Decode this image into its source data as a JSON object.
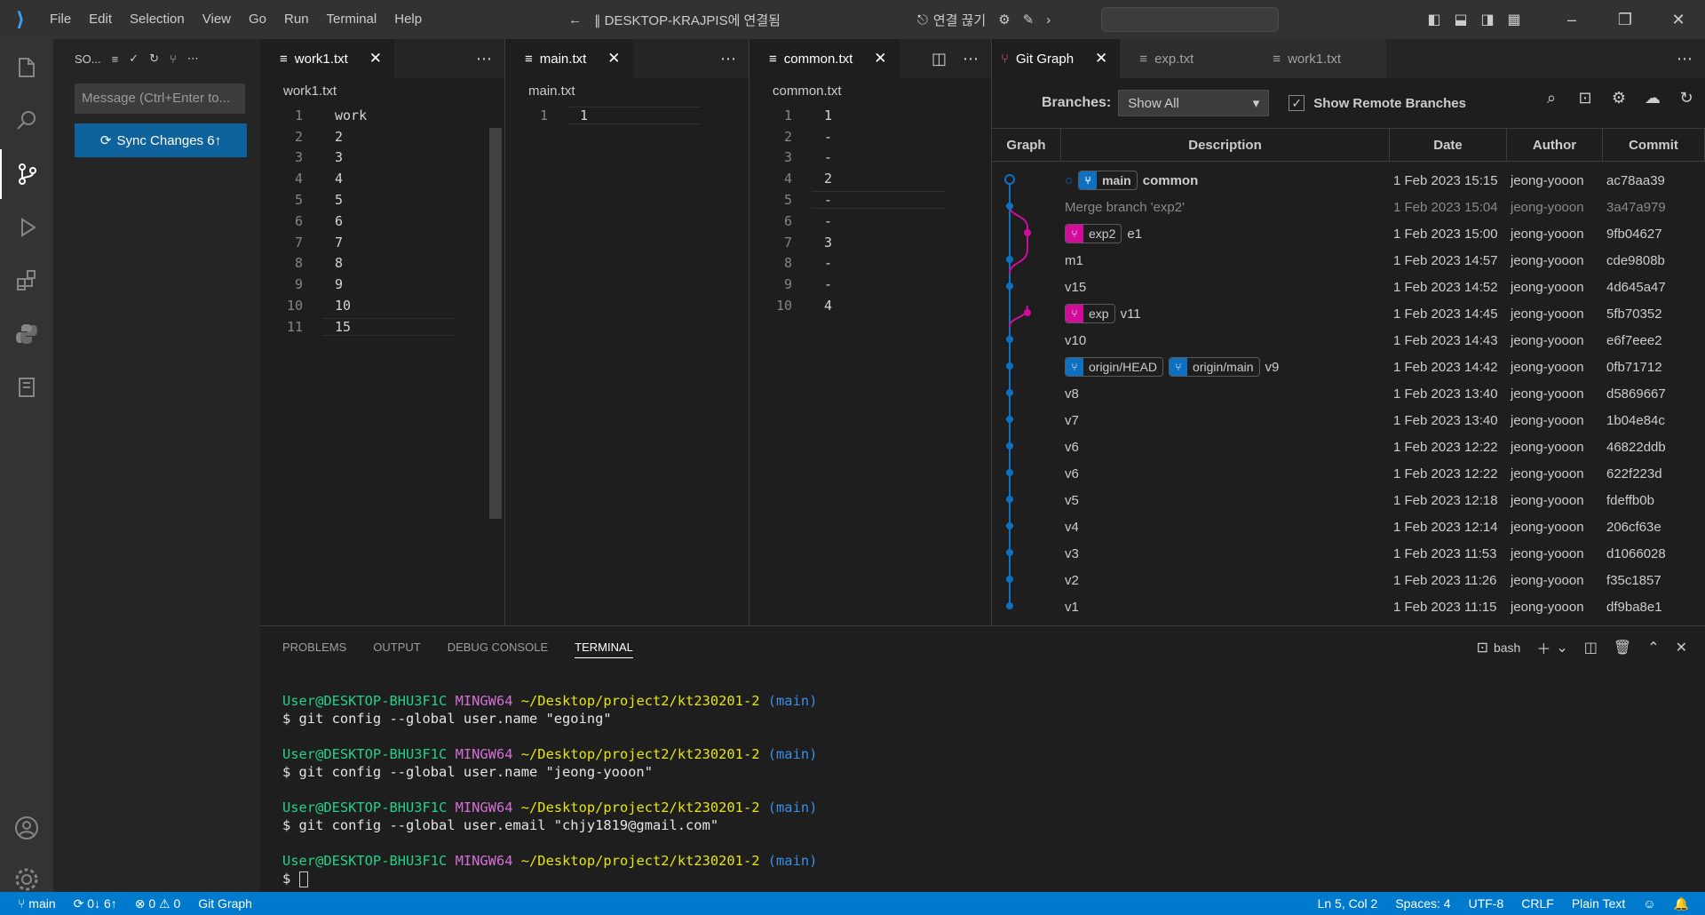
{
  "titlebar": {
    "menu": [
      "File",
      "Edit",
      "Selection",
      "View",
      "Go",
      "Run",
      "Terminal",
      "Help"
    ],
    "remote_title": "∥ DESKTOP-KRAJPIS에 연결됨",
    "disconnect": "연결 끊기"
  },
  "sidebar": {
    "title": "SO...",
    "message_placeholder": "Message (Ctrl+Enter to...",
    "sync_label": "Sync Changes 6↑"
  },
  "editors": [
    {
      "tab": "work1.txt",
      "crumb": "work1.txt",
      "lines": [
        "work",
        "2",
        "3",
        "4",
        "5",
        "6",
        "7",
        "8",
        "9",
        "10",
        "15"
      ]
    },
    {
      "tab": "main.txt",
      "crumb": "main.txt",
      "lines": [
        "1"
      ]
    },
    {
      "tab": "common.txt",
      "crumb": "common.txt",
      "lines": [
        "1",
        "-",
        "-",
        "2",
        "-",
        "-",
        "3",
        "-",
        "-",
        "4"
      ]
    }
  ],
  "gitgraph": {
    "tabs": [
      "Git Graph",
      "exp.txt",
      "work1.txt"
    ],
    "branches_label": "Branches:",
    "branches_value": "Show All",
    "show_remote_label": "Show Remote Branches",
    "columns": [
      "Graph",
      "Description",
      "Date",
      "Author",
      "Commit"
    ],
    "rows": [
      {
        "refs": [
          {
            "name": "main",
            "color": "blue",
            "head": true
          }
        ],
        "desc": "common",
        "date": "1 Feb 2023 15:15",
        "author": "jeong-yooon",
        "commit": "ac78aa39"
      },
      {
        "refs": [],
        "desc": "Merge branch 'exp2'",
        "date": "1 Feb 2023 15:04",
        "author": "jeong-yooon",
        "commit": "3a47a979",
        "dim": true
      },
      {
        "refs": [
          {
            "name": "exp2",
            "color": "pink"
          }
        ],
        "desc": "e1",
        "date": "1 Feb 2023 15:00",
        "author": "jeong-yooon",
        "commit": "9fb04627"
      },
      {
        "refs": [],
        "desc": "m1",
        "date": "1 Feb 2023 14:57",
        "author": "jeong-yooon",
        "commit": "cde9808b"
      },
      {
        "refs": [],
        "desc": "v15",
        "date": "1 Feb 2023 14:52",
        "author": "jeong-yooon",
        "commit": "4d645a47"
      },
      {
        "refs": [
          {
            "name": "exp",
            "color": "pink"
          }
        ],
        "desc": "v11",
        "date": "1 Feb 2023 14:45",
        "author": "jeong-yooon",
        "commit": "5fb70352"
      },
      {
        "refs": [],
        "desc": "v10",
        "date": "1 Feb 2023 14:43",
        "author": "jeong-yooon",
        "commit": "e6f7eee2"
      },
      {
        "refs": [
          {
            "name": "origin/HEAD",
            "color": "blue"
          },
          {
            "name": "origin/main",
            "color": "blue"
          }
        ],
        "desc": "v9",
        "date": "1 Feb 2023 14:42",
        "author": "jeong-yooon",
        "commit": "0fb71712"
      },
      {
        "refs": [],
        "desc": "v8",
        "date": "1 Feb 2023 13:40",
        "author": "jeong-yooon",
        "commit": "d5869667"
      },
      {
        "refs": [],
        "desc": "v7",
        "date": "1 Feb 2023 13:40",
        "author": "jeong-yooon",
        "commit": "1b04e84c"
      },
      {
        "refs": [],
        "desc": "v6",
        "date": "1 Feb 2023 12:22",
        "author": "jeong-yooon",
        "commit": "46822ddb"
      },
      {
        "refs": [],
        "desc": "v6",
        "date": "1 Feb 2023 12:22",
        "author": "jeong-yooon",
        "commit": "622f223d"
      },
      {
        "refs": [],
        "desc": "v5",
        "date": "1 Feb 2023 12:18",
        "author": "jeong-yooon",
        "commit": "fdeffb0b"
      },
      {
        "refs": [],
        "desc": "v4",
        "date": "1 Feb 2023 12:14",
        "author": "jeong-yooon",
        "commit": "206cf63e"
      },
      {
        "refs": [],
        "desc": "v3",
        "date": "1 Feb 2023 11:53",
        "author": "jeong-yooon",
        "commit": "d1066028"
      },
      {
        "refs": [],
        "desc": "v2",
        "date": "1 Feb 2023 11:26",
        "author": "jeong-yooon",
        "commit": "f35c1857"
      },
      {
        "refs": [],
        "desc": "v1",
        "date": "1 Feb 2023 11:15",
        "author": "jeong-yooon",
        "commit": "df9ba8e1"
      }
    ]
  },
  "panel": {
    "tabs": [
      "PROBLEMS",
      "OUTPUT",
      "DEBUG CONSOLE",
      "TERMINAL"
    ],
    "shell": "bash",
    "terminal": [
      {
        "user": "User@DESKTOP-BHU3F1C",
        "ming": "MINGW64",
        "path": "~/Desktop/project2/kt230201-2",
        "branch": "(main)",
        "cmd": "$ git config --global user.name \"egoing\""
      },
      {
        "user": "User@DESKTOP-BHU3F1C",
        "ming": "MINGW64",
        "path": "~/Desktop/project2/kt230201-2",
        "branch": "(main)",
        "cmd": "$ git config --global user.name \"jeong-yooon\""
      },
      {
        "user": "User@DESKTOP-BHU3F1C",
        "ming": "MINGW64",
        "path": "~/Desktop/project2/kt230201-2",
        "branch": "(main)",
        "cmd": "$ git config --global user.email \"chjy1819@gmail.com\""
      },
      {
        "user": "User@DESKTOP-BHU3F1C",
        "ming": "MINGW64",
        "path": "~/Desktop/project2/kt230201-2",
        "branch": "(main)",
        "cmd": "$ "
      }
    ]
  },
  "statusbar": {
    "branch": "main",
    "sync": "0↓ 6↑",
    "problems": "⊗ 0 ⚠ 0",
    "gitgraph": "Git Graph",
    "position": "Ln 5, Col 2",
    "spaces": "Spaces: 4",
    "encoding": "UTF-8",
    "eol": "CRLF",
    "language": "Plain Text"
  },
  "colors": {
    "accent": "#007acc",
    "main_branch": "#0e70c0",
    "exp_branch": "#d10c9b"
  }
}
